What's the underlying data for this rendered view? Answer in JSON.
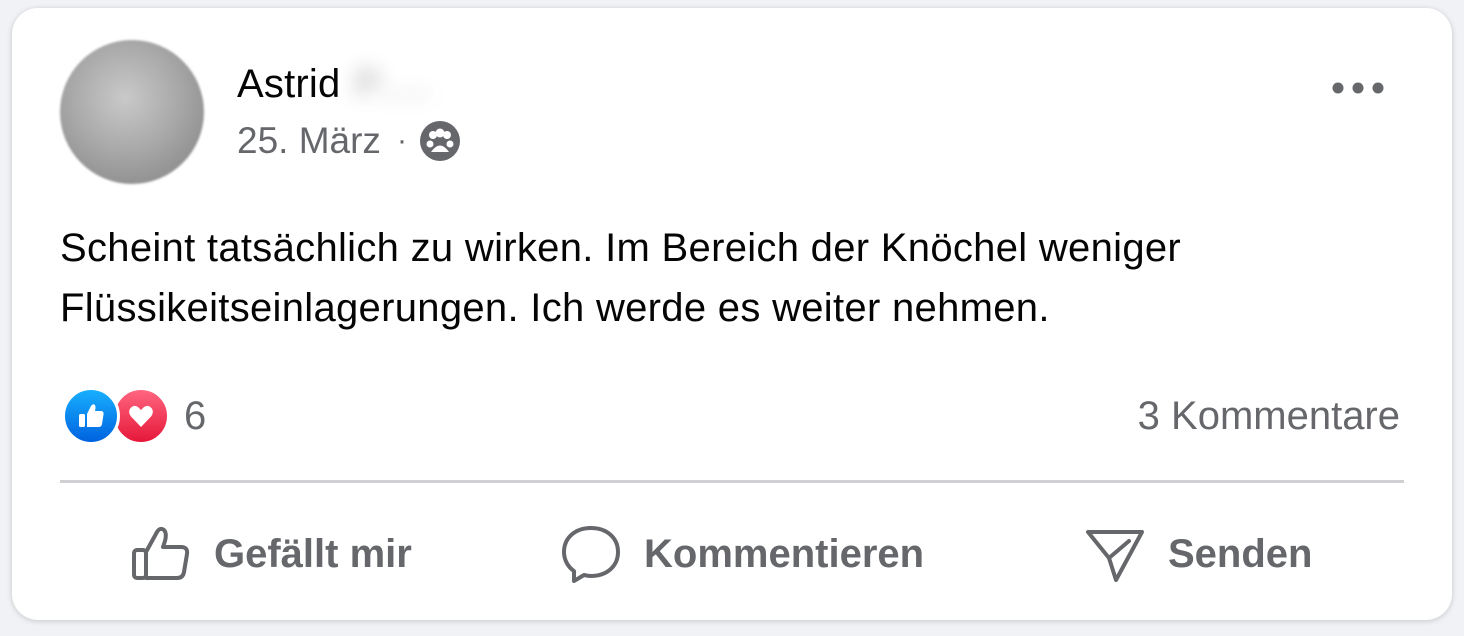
{
  "post": {
    "author_first_name": "Astrid",
    "author_last_name_blurred": "P.....",
    "date": "25. März",
    "meta_separator": "·",
    "audience_icon": "friends-icon",
    "more_icon": "more-options-icon",
    "text": "Scheint tatsächlich zu wirken. Im Bereich der Knöchel weniger Flüssikeitseinlagerungen. Ich werde es weiter nehmen."
  },
  "stats": {
    "reaction_icons": [
      "like-reaction-icon",
      "love-reaction-icon"
    ],
    "reaction_count": "6",
    "comments": "3 Kommentare"
  },
  "actions": {
    "like_label": "Gefällt mir",
    "comment_label": "Kommentieren",
    "send_label": "Senden"
  },
  "colors": {
    "like_blue": "#0866ff",
    "love_red": "#f33e58",
    "secondary_text": "#65676b",
    "primary_text": "#050505",
    "divider": "#ced0d4"
  }
}
